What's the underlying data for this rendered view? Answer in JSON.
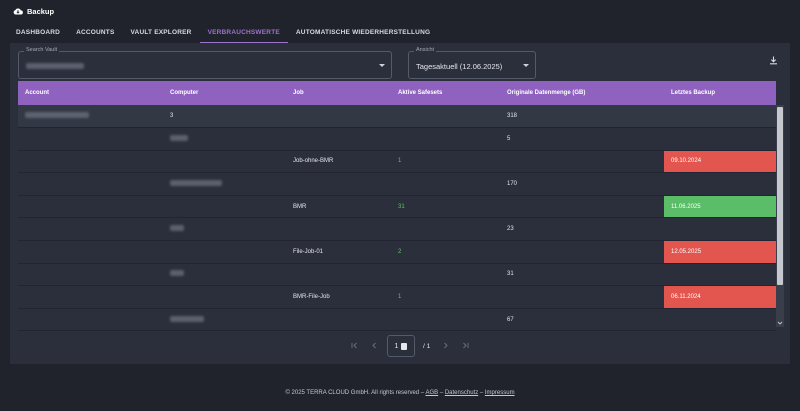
{
  "app": {
    "title": "Backup"
  },
  "nav": {
    "tabs": [
      {
        "label": "DASHBOARD"
      },
      {
        "label": "ACCOUNTS"
      },
      {
        "label": "VAULT EXPLORER"
      },
      {
        "label": "VERBRAUCHSWERTE"
      },
      {
        "label": "AUTOMATISCHE WIEDERHERSTELLUNG"
      }
    ],
    "active": "VERBRAUCHSWERTE"
  },
  "filters": {
    "vault": {
      "label": "Search Vault",
      "value": ""
    },
    "ansicht": {
      "label": "Ansicht",
      "value": "Tagesaktuell (12.06.2025)"
    }
  },
  "table": {
    "columns": [
      "Account",
      "Computer",
      "Job",
      "Aktive Safesets",
      "Originale Datenmenge (GB)",
      "Letztes Backup"
    ],
    "rows": [
      {
        "level": 0,
        "computer": "3",
        "job": "",
        "safesets": "",
        "size": "318",
        "last_backup": "",
        "status": ""
      },
      {
        "level": 1,
        "computer": "",
        "job": "",
        "safesets": "",
        "size": "5",
        "last_backup": "",
        "status": ""
      },
      {
        "level": 2,
        "computer": "",
        "job": "Job-ohne-BMR",
        "safesets": "1",
        "size": "",
        "last_backup": "09.10.2024",
        "status": "red"
      },
      {
        "level": 1,
        "computer": "",
        "job": "",
        "safesets": "",
        "size": "170",
        "last_backup": "",
        "status": ""
      },
      {
        "level": 2,
        "computer": "",
        "job": "BMR",
        "safesets": "31",
        "size": "",
        "last_backup": "11.06.2025",
        "status": "green"
      },
      {
        "level": 1,
        "computer": "",
        "job": "",
        "safesets": "",
        "size": "23",
        "last_backup": "",
        "status": ""
      },
      {
        "level": 2,
        "computer": "",
        "job": "File-Job-01",
        "safesets": "2",
        "size": "",
        "last_backup": "12.05.2025",
        "status": "red"
      },
      {
        "level": 1,
        "computer": "",
        "job": "",
        "safesets": "",
        "size": "31",
        "last_backup": "",
        "status": ""
      },
      {
        "level": 2,
        "computer": "",
        "job": "BMR-File-Job",
        "safesets": "1",
        "size": "",
        "last_backup": "06.11.2024",
        "status": "red"
      },
      {
        "level": 1,
        "computer": "",
        "job": "",
        "safesets": "",
        "size": "67",
        "last_backup": "",
        "status": ""
      }
    ]
  },
  "pager": {
    "current": "1",
    "total": "/ 1"
  },
  "footer": {
    "copyright": "© 2025 TERRA CLOUD GmbH. All rights reserved –",
    "links": [
      "AGB",
      "Datenschutz",
      "Impressum"
    ],
    "sep": "–"
  },
  "colors": {
    "header_purple": "#8f62c0",
    "active_tab": "#9b73c9",
    "status_red": "#e3564f",
    "status_green": "#5bbd67",
    "safeset_green": "#63c06b"
  },
  "icons": [
    "cloud-icon",
    "caret-down-icon",
    "download-icon",
    "first-page-icon",
    "prev-page-icon",
    "next-page-icon",
    "last-page-icon"
  ]
}
